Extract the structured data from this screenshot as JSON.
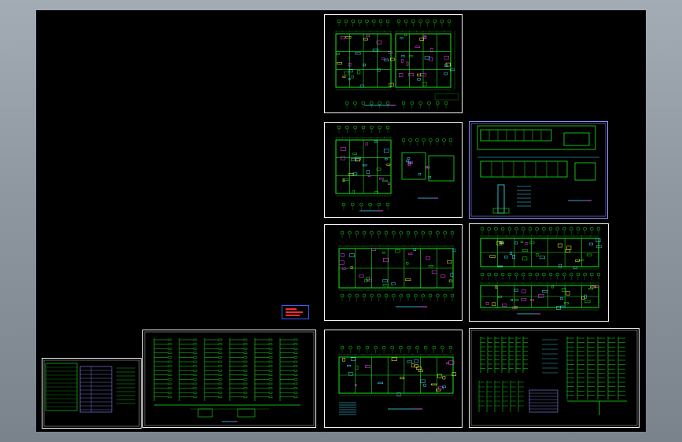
{
  "viewport": {
    "background_color": "#000000",
    "outer_color": "#8e96a0"
  },
  "colors": {
    "wall": "#19e619",
    "wall_dim": "#0fa00f",
    "highlight_cyan": "#3fe0ff",
    "highlight_magenta": "#ff3cff",
    "highlight_yellow": "#ffff3c",
    "frame": "#f2f2f2",
    "frame_blue": "#8e8eff",
    "legend_red": "#ff2a2a",
    "legend_blue": "#3b5bff"
  },
  "sheets": [
    {
      "id": "sheet-floor-plan-typical",
      "kind": "dual-plan",
      "caption": ""
    },
    {
      "id": "sheet-floor-plan-units",
      "kind": "plan-with-details",
      "caption": ""
    },
    {
      "id": "sheet-site-plan",
      "kind": "site",
      "caption": ""
    },
    {
      "id": "sheet-long-plan-1",
      "kind": "long-plan",
      "caption": ""
    },
    {
      "id": "sheet-long-plan-2",
      "kind": "double-long-plan",
      "caption": ""
    },
    {
      "id": "sheet-long-plan-3",
      "kind": "long-plan-cyan",
      "caption": ""
    },
    {
      "id": "sheet-riser-diagram",
      "kind": "riser",
      "caption": ""
    },
    {
      "id": "sheet-system-diagram",
      "kind": "system",
      "caption": ""
    },
    {
      "id": "sheet-legend-table",
      "kind": "table",
      "caption": ""
    }
  ],
  "legend_box": {
    "id": "legend-box"
  }
}
